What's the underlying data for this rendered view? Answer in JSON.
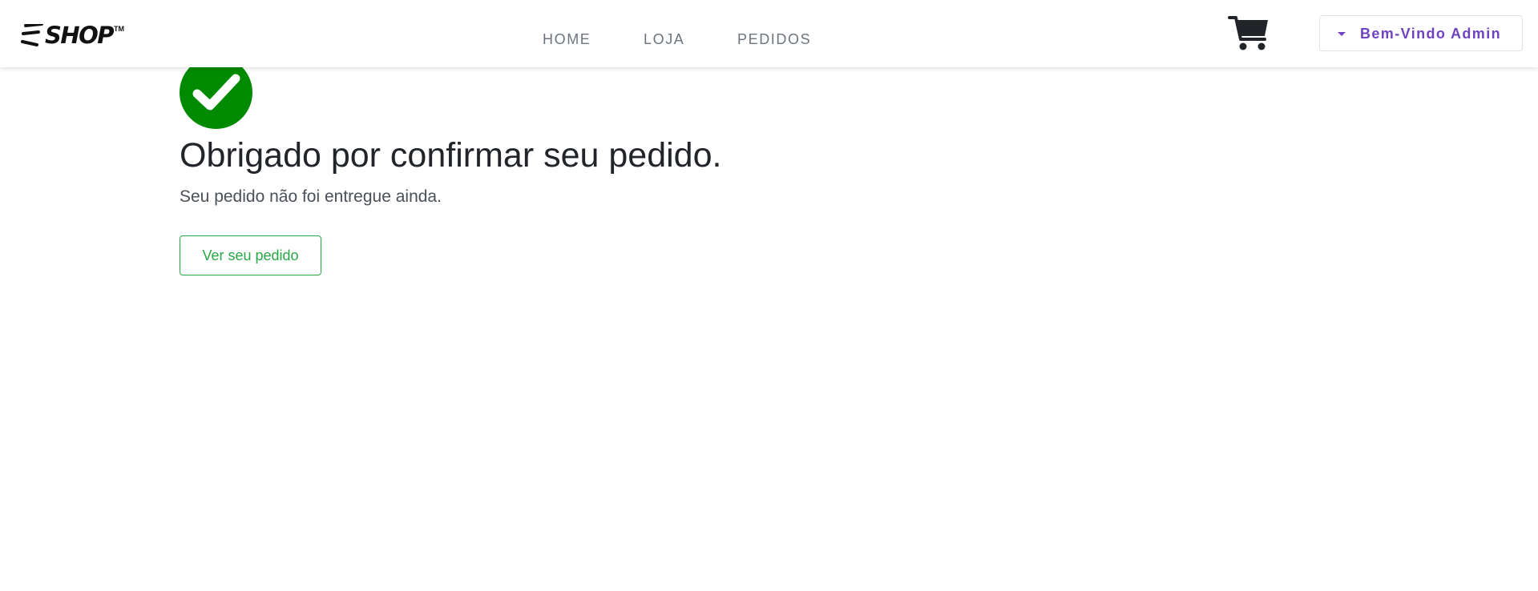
{
  "brand": {
    "logo_text": "SHOP",
    "logo_trademark": "TM"
  },
  "nav": {
    "items": [
      {
        "label": "HOME"
      },
      {
        "label": "LOJA"
      },
      {
        "label": "PEDIDOS"
      }
    ]
  },
  "header": {
    "cart_icon": "shopping-cart-icon",
    "user_menu_label": "Bem-Vindo Admin"
  },
  "confirmation": {
    "icon": "check-circle-icon",
    "title": "Obrigado por confirmar seu pedido.",
    "message": "Seu pedido não foi entregue ainda.",
    "view_order_label": "Ver seu pedido"
  },
  "colors": {
    "success": "#008a00",
    "button_outline": "#28a745",
    "user_menu": "#6f42c1",
    "nav_text": "#6c757d"
  }
}
